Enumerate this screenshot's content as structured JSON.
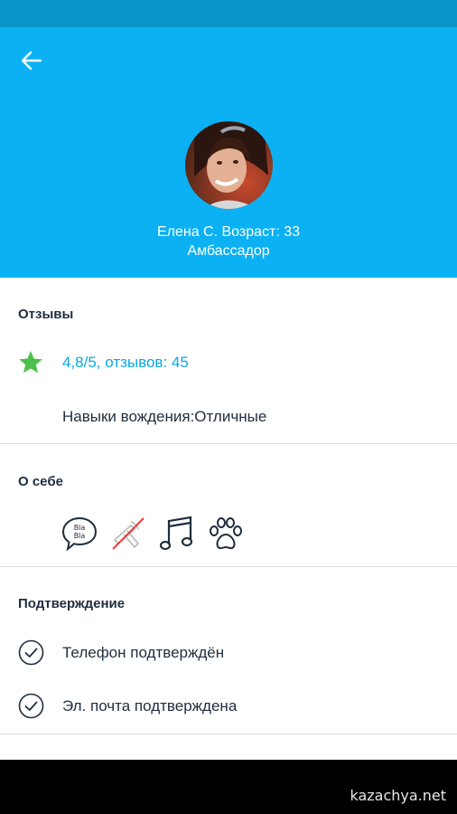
{
  "profile": {
    "name_age": "Елена С. Возраст: 33",
    "role": "Амбассадор"
  },
  "reviews": {
    "title": "Отзывы",
    "rating_text": "4,8/5, отзывов: 45",
    "driving_skills": "Навыки вождения:Отличные"
  },
  "about": {
    "title": "О себе",
    "icons": [
      "chat-bubble-icon",
      "no-smoking-icon",
      "music-note-icon",
      "paw-icon"
    ],
    "chat_text_line1": "Bla",
    "chat_text_line2": "Bla"
  },
  "verification": {
    "title": "Подтверждение",
    "items": [
      {
        "label": "Телефон подтверждён"
      },
      {
        "label": "Эл. почта подтверждена"
      }
    ]
  },
  "watermark": "kazachya.net",
  "colors": {
    "header": "#0bb1f2",
    "status_bar": "#0996c8",
    "accent": "#0ba8e0",
    "star": "#4cc04c"
  }
}
